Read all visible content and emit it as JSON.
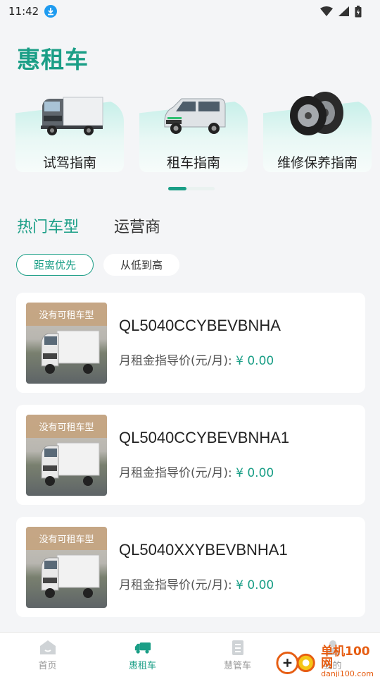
{
  "status_bar": {
    "time": "11:42"
  },
  "app_title": "惠租车",
  "guides": [
    {
      "label": "试驾指南",
      "icon": "box-truck-image"
    },
    {
      "label": "租车指南",
      "icon": "van-image"
    },
    {
      "label": "维修保养指南",
      "icon": "tires-image"
    }
  ],
  "tabs": [
    {
      "label": "热门车型",
      "active": true
    },
    {
      "label": "运营商",
      "active": false
    }
  ],
  "filters": [
    {
      "label": "距离优先",
      "active": true
    },
    {
      "label": "从低到高",
      "active": false
    }
  ],
  "cars": [
    {
      "badge": "没有可租车型",
      "name": "QL5040CCYBEVBNHA",
      "price_label": "月租金指导价(元/月):",
      "price": "¥ 0.00"
    },
    {
      "badge": "没有可租车型",
      "name": "QL5040CCYBEVBNHA1",
      "price_label": "月租金指导价(元/月):",
      "price": "¥ 0.00"
    },
    {
      "badge": "没有可租车型",
      "name": "QL5040XXYBEVBNHA1",
      "price_label": "月租金指导价(元/月):",
      "price": "¥ 0.00"
    }
  ],
  "bottom_nav": [
    {
      "label": "首页",
      "icon": "home-icon",
      "active": false
    },
    {
      "label": "惠租车",
      "icon": "truck-icon",
      "active": true
    },
    {
      "label": "慧管车",
      "icon": "clipboard-icon",
      "active": false
    },
    {
      "label": "我的",
      "icon": "user-icon",
      "active": false
    }
  ],
  "watermark": {
    "cn": "单机100网",
    "en": "danji100.com"
  },
  "colors": {
    "accent": "#1a9e86",
    "badge": "#c4a480"
  }
}
